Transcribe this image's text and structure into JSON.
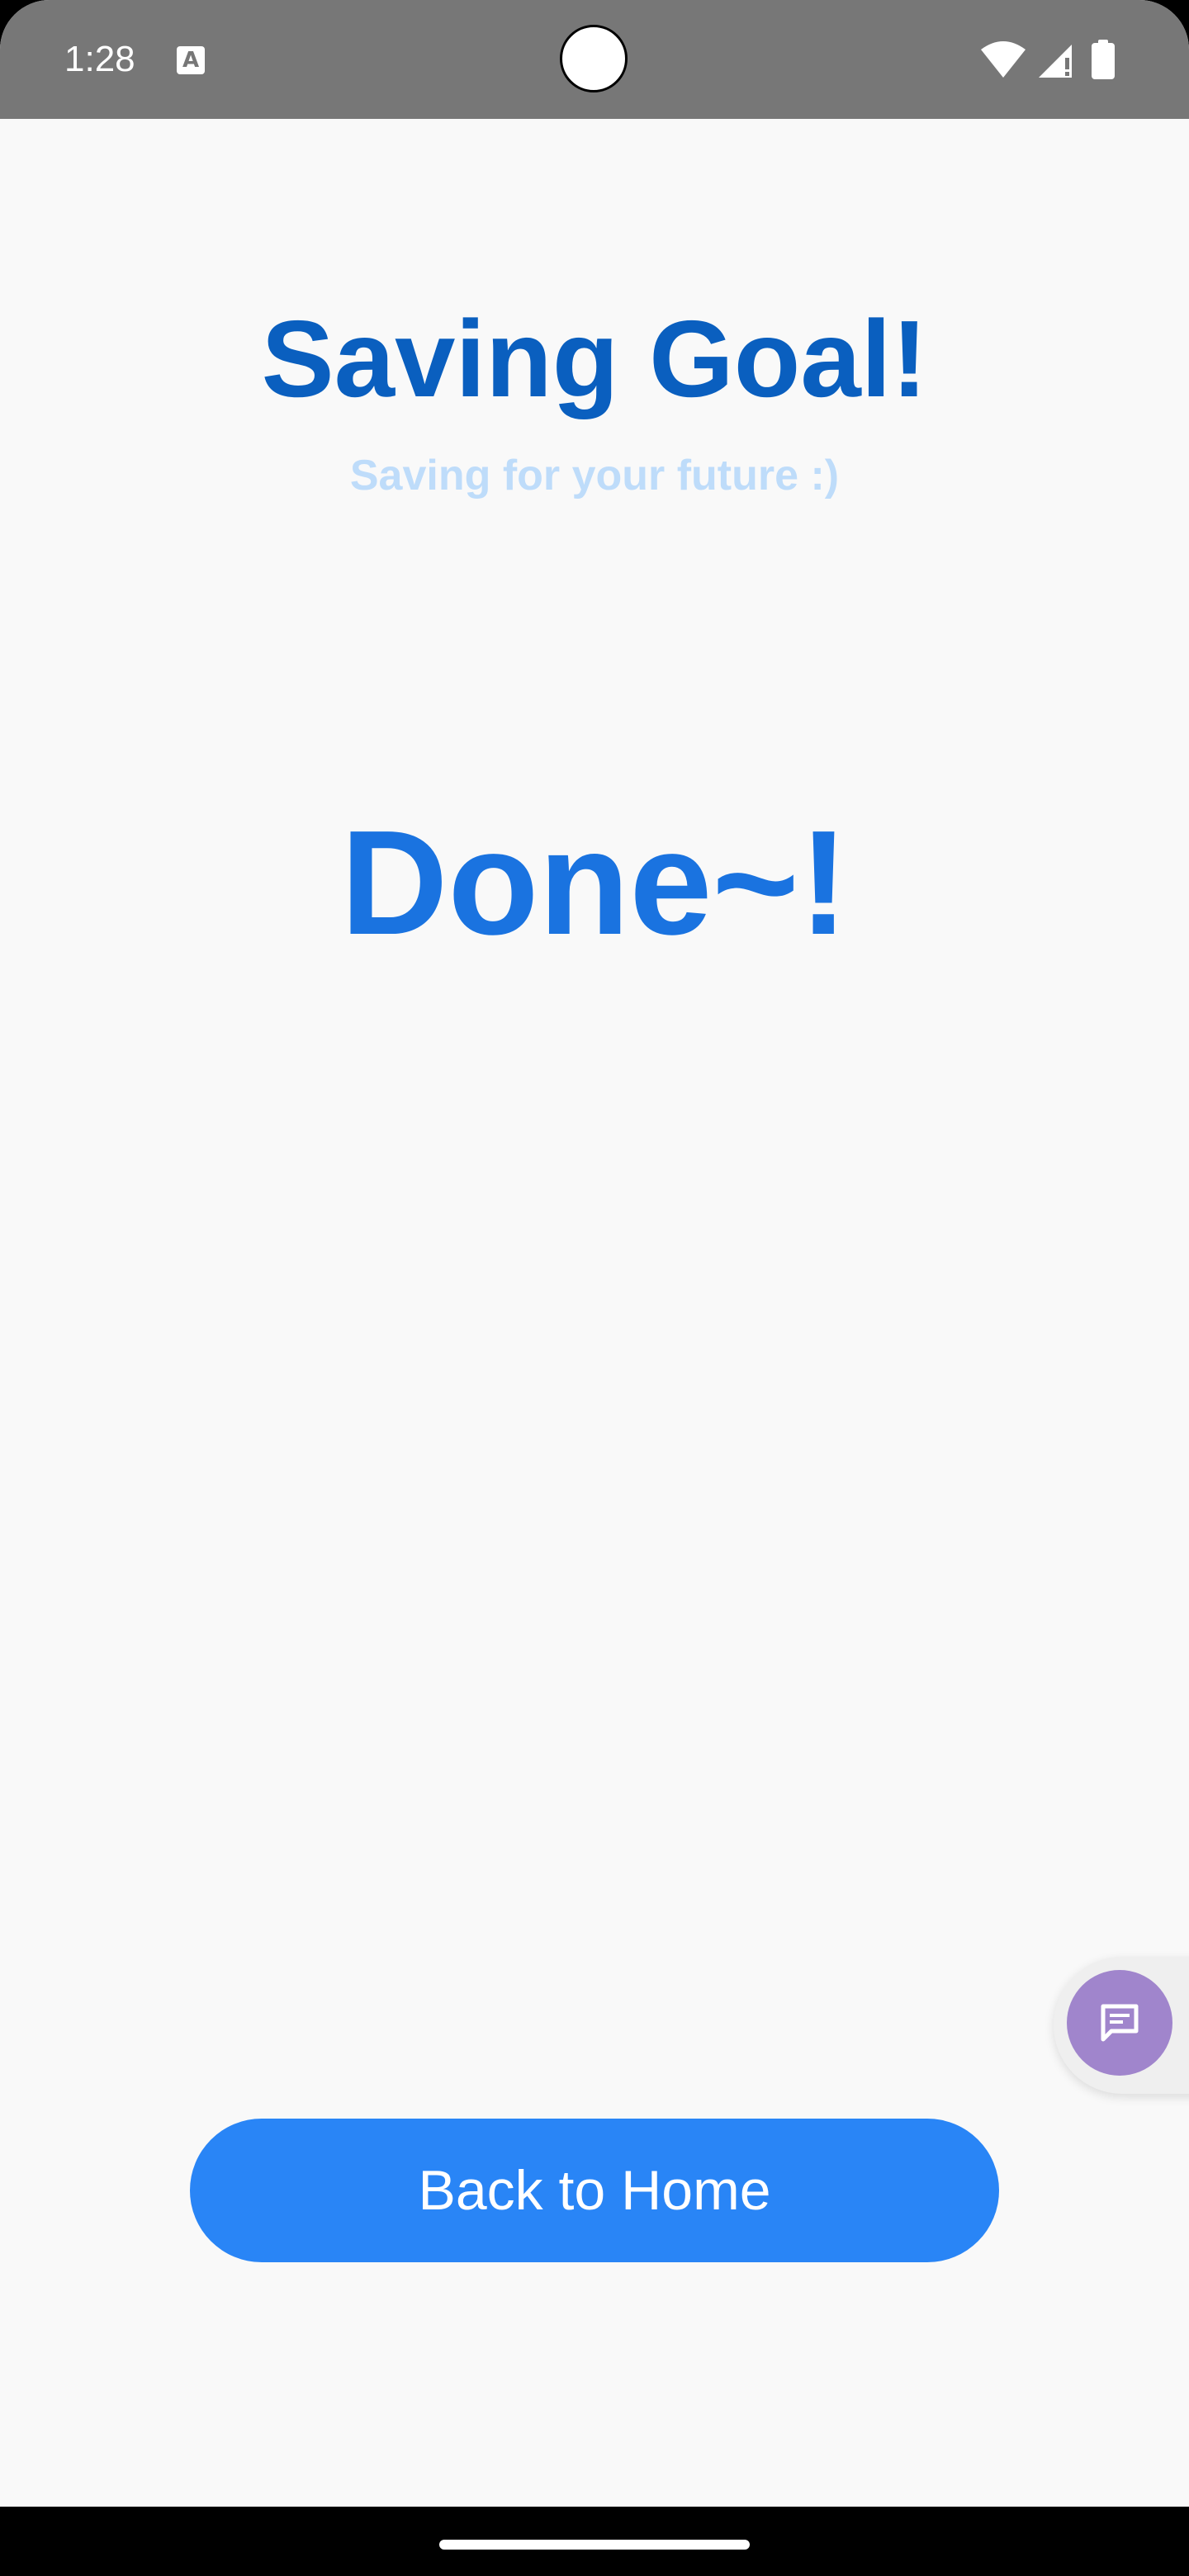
{
  "status_bar": {
    "time": "1:28",
    "keyboard_badge": "A",
    "icons": [
      "wifi-icon",
      "signal-icon",
      "battery-icon"
    ]
  },
  "header": {
    "title": "Saving Goal!",
    "subtitle": "Saving for your future :)"
  },
  "main": {
    "message": "Done~!"
  },
  "floating_action": {
    "icon": "chat-bubble-icon"
  },
  "actions": {
    "back_home_label": "Back to Home"
  },
  "colors": {
    "title": "#0a5fbf",
    "subtitle": "#bedcfa",
    "message": "#1a73e0",
    "button": "#2985f6",
    "fab": "#a085cc",
    "status_bar": "#777777",
    "background": "#f9f9f9"
  }
}
